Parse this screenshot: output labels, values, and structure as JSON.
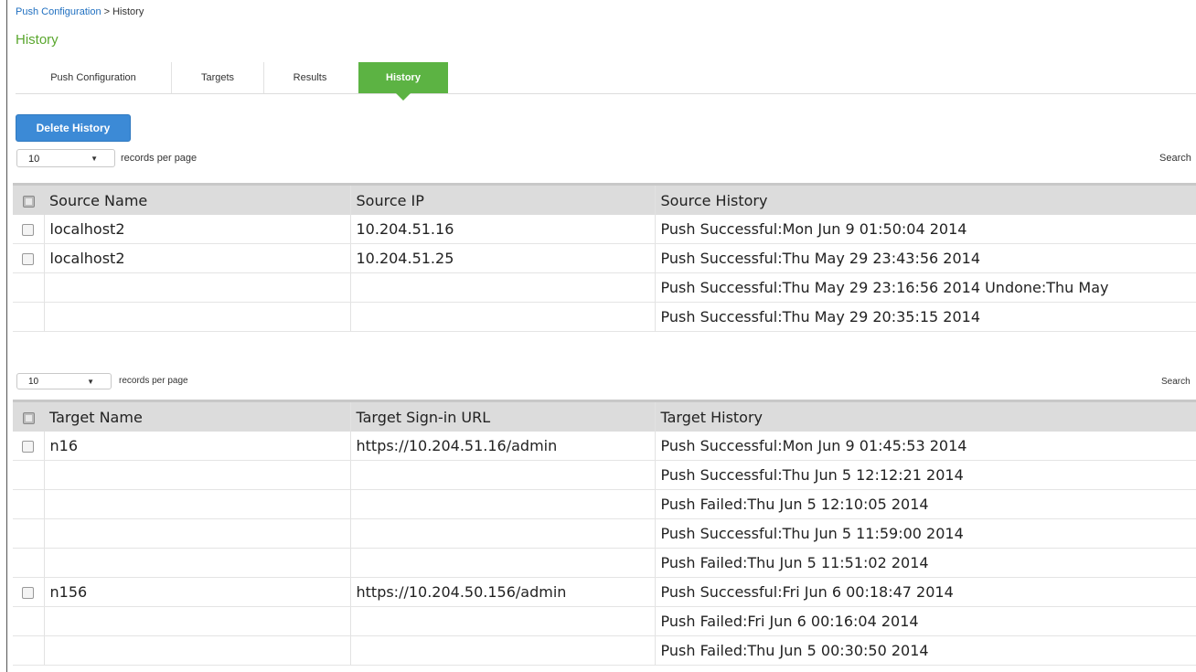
{
  "breadcrumb": {
    "parent": "Push Configuration",
    "separator": " > ",
    "current": "History"
  },
  "page_title": "History",
  "tabs": [
    {
      "label": "Push Configuration",
      "active": false
    },
    {
      "label": "Targets",
      "active": false
    },
    {
      "label": "Results",
      "active": false
    },
    {
      "label": "History",
      "active": true
    }
  ],
  "delete_button": "Delete History",
  "source_section": {
    "page_size": "10",
    "records_per_page_label": "records per page",
    "search_label": "Search",
    "columns": [
      "Source Name",
      "Source IP",
      "Source History"
    ],
    "rows": [
      {
        "checkbox": true,
        "name": "localhost2",
        "ip": "10.204.51.16",
        "history": "Push Successful:Mon Jun 9 01:50:04 2014"
      },
      {
        "checkbox": true,
        "name": "localhost2",
        "ip": "10.204.51.25",
        "history": "Push Successful:Thu May 29 23:43:56 2014"
      },
      {
        "checkbox": false,
        "name": "",
        "ip": "",
        "history": "Push Successful:Thu May 29 23:16:56 2014 Undone:Thu May"
      },
      {
        "checkbox": false,
        "name": "",
        "ip": "",
        "history": "Push Successful:Thu May 29 20:35:15 2014"
      }
    ]
  },
  "target_section": {
    "page_size": "10",
    "records_per_page_label": "records per page",
    "search_label": "Search",
    "columns": [
      "Target Name",
      "Target Sign-in URL",
      "Target History"
    ],
    "rows": [
      {
        "checkbox": true,
        "name": "n16",
        "url": "https://10.204.51.16/admin",
        "history": "Push Successful:Mon Jun 9 01:45:53 2014"
      },
      {
        "checkbox": false,
        "name": "",
        "url": "",
        "history": "Push Successful:Thu Jun 5 12:12:21 2014"
      },
      {
        "checkbox": false,
        "name": "",
        "url": "",
        "history": "Push Failed:Thu Jun 5 12:10:05 2014"
      },
      {
        "checkbox": false,
        "name": "",
        "url": "",
        "history": "Push Successful:Thu Jun 5 11:59:00 2014"
      },
      {
        "checkbox": false,
        "name": "",
        "url": "",
        "history": "Push Failed:Thu Jun 5 11:51:02 2014"
      },
      {
        "checkbox": true,
        "name": "n156",
        "url": "https://10.204.50.156/admin",
        "history": "Push Successful:Fri Jun 6 00:18:47 2014"
      },
      {
        "checkbox": false,
        "name": "",
        "url": "",
        "history": "Push Failed:Fri Jun 6 00:16:04 2014"
      },
      {
        "checkbox": false,
        "name": "",
        "url": "",
        "history": "Push Failed:Thu Jun 5 00:30:50 2014"
      }
    ]
  },
  "colors": {
    "accent_green": "#5cb343",
    "button_blue": "#3c8ad6",
    "link_blue": "#1f6fc0",
    "header_gray": "#dcdcdc"
  }
}
